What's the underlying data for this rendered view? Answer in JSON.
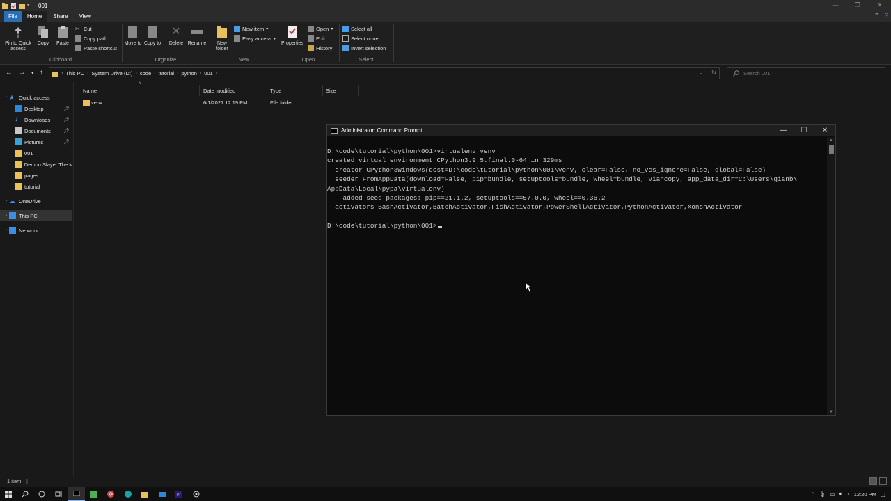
{
  "explorer": {
    "title": "001",
    "tabs": {
      "file": "File",
      "home": "Home",
      "share": "Share",
      "view": "View"
    },
    "ribbon": {
      "clipboard": {
        "label": "Clipboard",
        "pin": "Pin to Quick access",
        "copy": "Copy",
        "paste": "Paste",
        "cut": "Cut",
        "copy_path": "Copy path",
        "paste_shortcut": "Paste shortcut"
      },
      "organize": {
        "label": "Organize",
        "move_to": "Move to",
        "copy_to": "Copy to",
        "delete": "Delete",
        "rename": "Rename"
      },
      "new": {
        "label": "New",
        "new_folder": "New folder",
        "new_item": "New item",
        "easy_access": "Easy access"
      },
      "open": {
        "label": "Open",
        "properties": "Properties",
        "open": "Open",
        "edit": "Edit",
        "history": "History"
      },
      "select": {
        "label": "Select",
        "select_all": "Select all",
        "select_none": "Select none",
        "invert": "Invert selection"
      }
    },
    "breadcrumbs": [
      "This PC",
      "System Drive (D:)",
      "code",
      "tutorial",
      "python",
      "001"
    ],
    "search_placeholder": "Search 001",
    "nav": {
      "quick_access": "Quick access",
      "items": [
        "Desktop",
        "Downloads",
        "Documents",
        "Pictures",
        "001",
        "Demon Slayer The M",
        "pages",
        "tutorial"
      ],
      "onedrive": "OneDrive",
      "this_pc": "This PC",
      "network": "Network"
    },
    "columns": {
      "name": "Name",
      "date": "Date modified",
      "type": "Type",
      "size": "Size"
    },
    "files": [
      {
        "name": "venv",
        "date": "6/1/2021 12:19 PM",
        "type": "File folder"
      }
    ],
    "status": "1 item"
  },
  "cmd": {
    "title": "Administrator: Command Prompt",
    "lines": [
      "D:\\code\\tutorial\\python\\001>virtualenv venv",
      "created virtual environment CPython3.9.5.final.0-64 in 329ms",
      "  creator CPython3Windows(dest=D:\\code\\tutorial\\python\\001\\venv, clear=False, no_vcs_ignore=False, global=False)",
      "  seeder FromAppData(download=False, pip=bundle, setuptools=bundle, wheel=bundle, via=copy, app_data_dir=C:\\Users\\gianb\\",
      "AppData\\Local\\pypa\\virtualenv)",
      "    added seed packages: pip==21.1.2, setuptools==57.0.0, wheel==0.36.2",
      "  activators BashActivator,BatchActivator,FishActivator,PowerShellActivator,PythonActivator,XonshActivator",
      "",
      "D:\\code\\tutorial\\python\\001>"
    ]
  },
  "taskbar": {
    "time": "12:20 PM"
  },
  "colors": {
    "accent": "#2a6fb5",
    "folder": "#e8c15a",
    "background": "#191919",
    "console": "#0c0c0c"
  }
}
